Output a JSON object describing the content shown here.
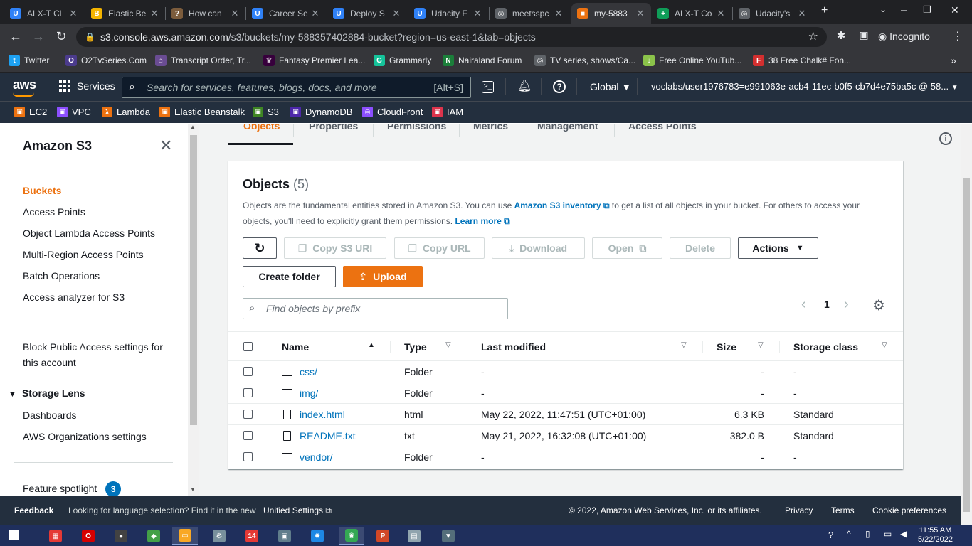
{
  "browser": {
    "tabs": [
      {
        "title": "ALX-T Cl",
        "icon": "U",
        "color": "#2f81f7",
        "active": false
      },
      {
        "title": "Elastic Be",
        "icon": "B",
        "color": "#f4b400",
        "active": false
      },
      {
        "title": "How can",
        "icon": "?",
        "color": "#7c5c3c",
        "active": false
      },
      {
        "title": "Career Se",
        "icon": "U",
        "color": "#2f81f7",
        "active": false
      },
      {
        "title": "Deploy S",
        "icon": "U",
        "color": "#2f81f7",
        "active": false
      },
      {
        "title": "Udacity F",
        "icon": "U",
        "color": "#2f81f7",
        "active": false
      },
      {
        "title": "meetsspc",
        "icon": "◎",
        "color": "#5f6368",
        "active": false
      },
      {
        "title": "my-5883",
        "icon": "■",
        "color": "#ec7211",
        "active": true
      },
      {
        "title": "ALX-T Co",
        "icon": "+",
        "color": "#0f9d58",
        "active": false
      },
      {
        "title": "Udacity's",
        "icon": "◎",
        "color": "#5f6368",
        "active": false
      }
    ],
    "url_host": "s3.console.aws.amazon.com",
    "url_path": "/s3/buckets/my-588357402884-bucket?region=us-east-1&tab=objects",
    "incognito_label": "Incognito",
    "bookmarks": [
      {
        "label": "Twitter",
        "icon": "t",
        "color": "#1da1f2"
      },
      {
        "label": "O2TvSeries.Com",
        "icon": "O",
        "color": "#4b3b8c"
      },
      {
        "label": "Transcript Order, Tr...",
        "icon": "⌂",
        "color": "#6a4c93"
      },
      {
        "label": "Fantasy Premier Lea...",
        "icon": "♛",
        "color": "#37003c"
      },
      {
        "label": "Grammarly",
        "icon": "G",
        "color": "#15c39a"
      },
      {
        "label": "Nairaland Forum",
        "icon": "N",
        "color": "#1b7f3a"
      },
      {
        "label": "TV series, shows/Ca...",
        "icon": "◎",
        "color": "#5f6368"
      },
      {
        "label": "Free Online YouTub...",
        "icon": "↓",
        "color": "#8bc34a"
      },
      {
        "label": "38 Free Chalk# Fon...",
        "icon": "F",
        "color": "#d32f2f"
      }
    ]
  },
  "aws": {
    "logo": "aws",
    "services_label": "Services",
    "search_placeholder": "Search for services, features, blogs, docs, and more",
    "search_shortcut": "[Alt+S]",
    "region_label": "Global",
    "account_label": "voclabs/user1976783=e991063e-acb4-11ec-b0f5-cb7d4e75ba5c @ 58...",
    "favorites": [
      {
        "label": "EC2",
        "color": "#ec7211",
        "icon": "▣"
      },
      {
        "label": "VPC",
        "color": "#8c4fff",
        "icon": "▣"
      },
      {
        "label": "Lambda",
        "color": "#ec7211",
        "icon": "λ"
      },
      {
        "label": "Elastic Beanstalk",
        "color": "#ec7211",
        "icon": "▣"
      },
      {
        "label": "S3",
        "color": "#3f8624",
        "icon": "▣"
      },
      {
        "label": "DynamoDB",
        "color": "#4d27aa",
        "icon": "▣"
      },
      {
        "label": "CloudFront",
        "color": "#8c4fff",
        "icon": "◎"
      },
      {
        "label": "IAM",
        "color": "#dd344c",
        "icon": "▣"
      }
    ]
  },
  "sidebar": {
    "title": "Amazon S3",
    "items": [
      {
        "label": "Buckets",
        "active": true
      },
      {
        "label": "Access Points"
      },
      {
        "label": "Object Lambda Access Points"
      },
      {
        "label": "Multi-Region Access Points"
      },
      {
        "label": "Batch Operations"
      },
      {
        "label": "Access analyzer for S3"
      }
    ],
    "block_public_line1": "Block Public Access settings for",
    "block_public_line2": "this account",
    "storage_lens_label": "Storage Lens",
    "storage_lens_items": [
      "Dashboards",
      "AWS Organizations settings"
    ],
    "feature_spotlight_label": "Feature spotlight",
    "feature_spotlight_count": "3"
  },
  "main": {
    "tabs": [
      "Objects",
      "Properties",
      "Permissions",
      "Metrics",
      "Management",
      "Access Points"
    ],
    "panel_title": "Objects",
    "panel_count": "(5)",
    "desc_part1": "Objects are the fundamental entities stored in Amazon S3. You can use ",
    "desc_link1": "Amazon S3 inventory",
    "desc_part2": " to get a list of all objects in your bucket. For others to access your",
    "desc_part3": "objects, you'll need to explicitly grant them permissions. ",
    "desc_link2": "Learn more",
    "buttons": {
      "copy_s3_uri": "Copy S3 URI",
      "copy_url": "Copy URL",
      "download": "Download",
      "open": "Open",
      "delete": "Delete",
      "actions": "Actions",
      "create_folder": "Create folder",
      "upload": "Upload"
    },
    "filter_placeholder": "Find objects by prefix",
    "page_number": "1",
    "columns": [
      "Name",
      "Type",
      "Last modified",
      "Size",
      "Storage class"
    ],
    "rows": [
      {
        "name": "css/",
        "type": "Folder",
        "modified": "-",
        "size": "-",
        "storage": "-",
        "kind": "folder"
      },
      {
        "name": "img/",
        "type": "Folder",
        "modified": "-",
        "size": "-",
        "storage": "-",
        "kind": "folder"
      },
      {
        "name": "index.html",
        "type": "html",
        "modified": "May 22, 2022, 11:47:51 (UTC+01:00)",
        "size": "6.3 KB",
        "storage": "Standard",
        "kind": "file"
      },
      {
        "name": "README.txt",
        "type": "txt",
        "modified": "May 21, 2022, 16:32:08 (UTC+01:00)",
        "size": "382.0 B",
        "storage": "Standard",
        "kind": "file"
      },
      {
        "name": "vendor/",
        "type": "Folder",
        "modified": "-",
        "size": "-",
        "storage": "-",
        "kind": "folder"
      }
    ]
  },
  "footer": {
    "feedback": "Feedback",
    "lang_text": "Looking for language selection? Find it in the new",
    "unified_settings": "Unified Settings",
    "copyright": "© 2022, Amazon Web Services, Inc. or its affiliates.",
    "privacy": "Privacy",
    "terms": "Terms",
    "cookie": "Cookie preferences"
  },
  "taskbar": {
    "time": "11:55 AM",
    "date": "5/22/2022",
    "apps": [
      {
        "name": "app-grid",
        "color": "#e53935",
        "icon": "▦"
      },
      {
        "name": "opera",
        "color": "#d50000",
        "icon": "O"
      },
      {
        "name": "camera-app",
        "color": "#424242",
        "icon": "●"
      },
      {
        "name": "photos",
        "color": "#43a047",
        "icon": "◆"
      },
      {
        "name": "file-explorer",
        "color": "#f9a825",
        "icon": "▭"
      },
      {
        "name": "settings-app",
        "color": "#78909c",
        "icon": "⚙"
      },
      {
        "name": "calendar-14",
        "color": "#e53935",
        "icon": "14"
      },
      {
        "name": "image-viewer",
        "color": "#607d8b",
        "icon": "▣"
      },
      {
        "name": "gear-app",
        "color": "#1e88e5",
        "icon": "✹"
      },
      {
        "name": "chrome",
        "color": "#34a853",
        "icon": "◉"
      },
      {
        "name": "powerpoint",
        "color": "#d24726",
        "icon": "P"
      },
      {
        "name": "notepad",
        "color": "#90a4ae",
        "icon": "▤"
      },
      {
        "name": "usb-drive",
        "color": "#546e7a",
        "icon": "▼"
      }
    ]
  }
}
